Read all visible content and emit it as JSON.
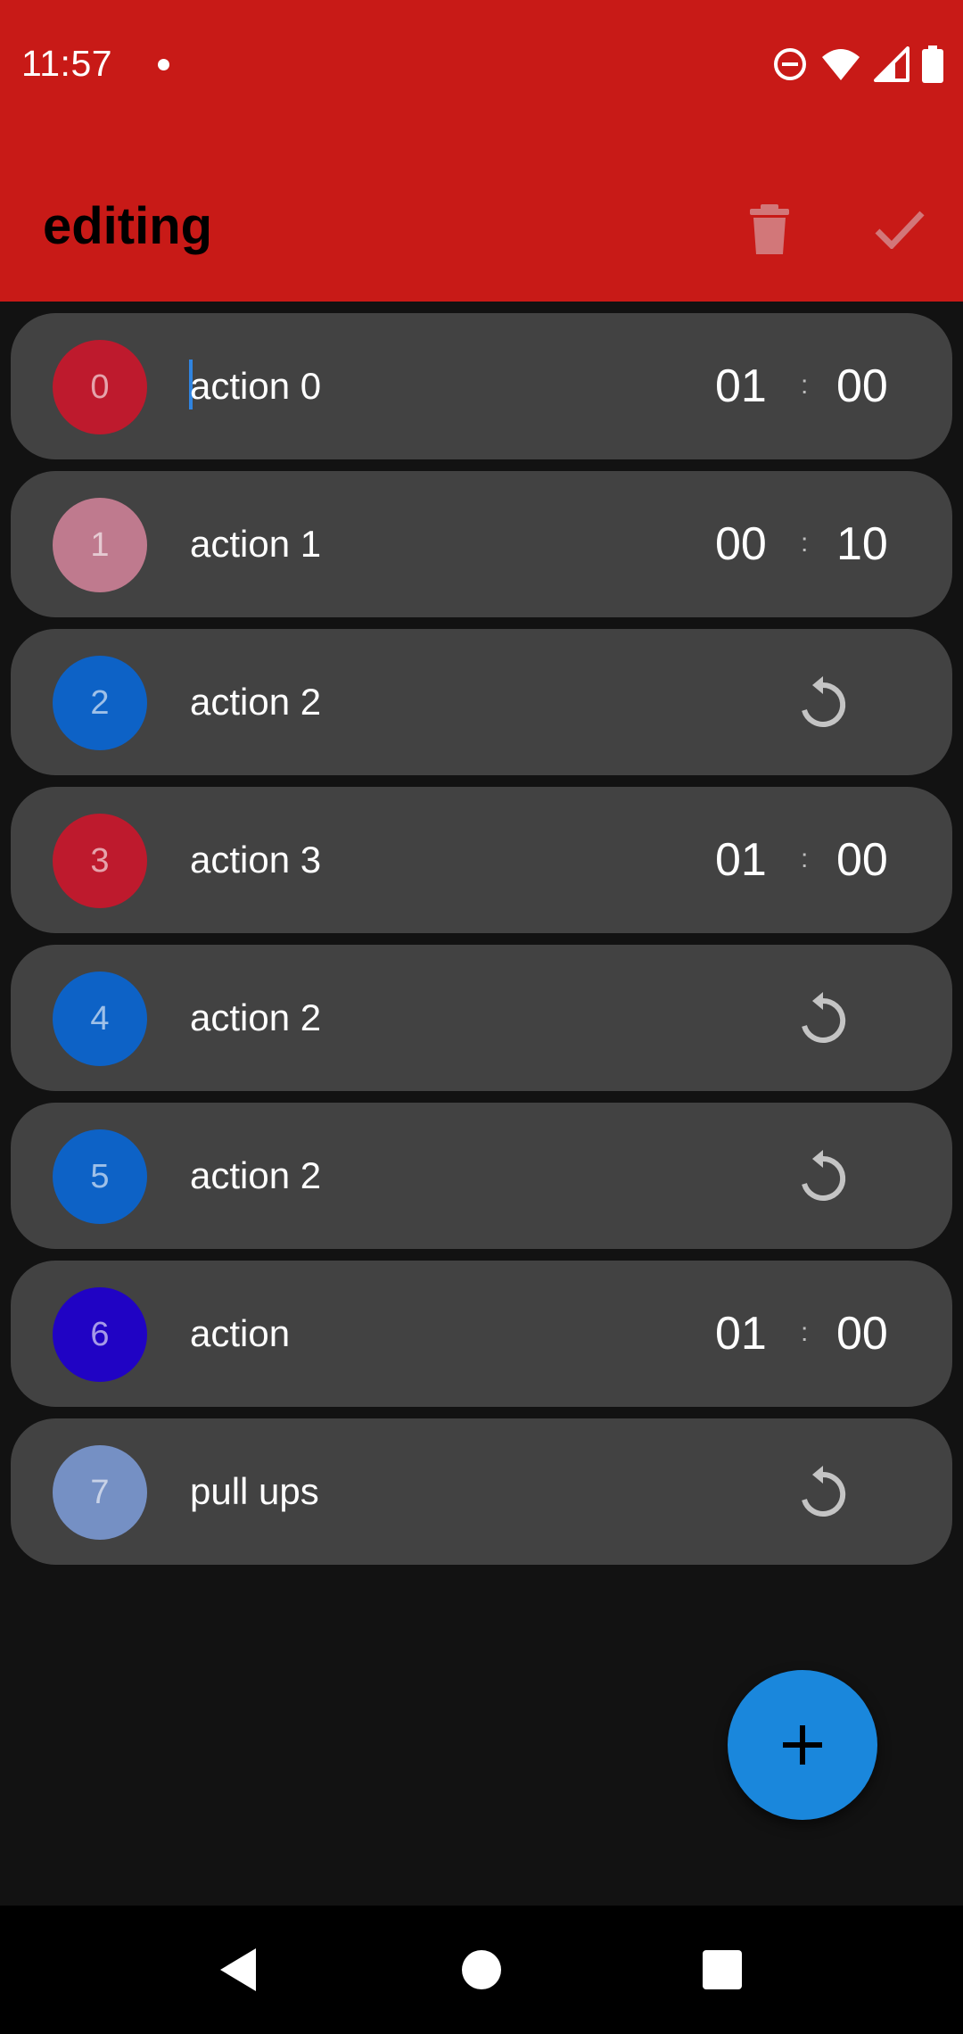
{
  "status_bar": {
    "time": "11:57"
  },
  "app_bar": {
    "title": "editing"
  },
  "colors": {
    "header": "#c81a17",
    "row_bg": "#424242",
    "fab": "#1a87dc",
    "caret": "#2f84e0"
  },
  "actions": [
    {
      "index": "0",
      "name": "action 0",
      "color": "#be1a2d",
      "type": "timer",
      "minutes": "01",
      "seconds": "00",
      "focused": true
    },
    {
      "index": "1",
      "name": "action 1",
      "color": "#bf7a8e",
      "type": "timer",
      "minutes": "00",
      "seconds": "10"
    },
    {
      "index": "2",
      "name": "action 2",
      "color": "#0d62c6",
      "type": "repeat",
      "icon": "repeat-icon"
    },
    {
      "index": "3",
      "name": "action 3",
      "color": "#be1a2d",
      "type": "timer",
      "minutes": "01",
      "seconds": "00"
    },
    {
      "index": "4",
      "name": "action 2",
      "color": "#0d62c6",
      "type": "repeat",
      "icon": "repeat-icon"
    },
    {
      "index": "5",
      "name": "action 2",
      "color": "#0d62c6",
      "type": "repeat",
      "icon": "repeat-icon"
    },
    {
      "index": "6",
      "name": "action",
      "color": "#2003c4",
      "type": "timer",
      "minutes": "01",
      "seconds": "00"
    },
    {
      "index": "7",
      "name": "pull ups",
      "color": "#7590c4",
      "type": "repeat",
      "icon": "repeat-icon"
    }
  ],
  "timer_separator": ":",
  "icons": {
    "delete": "trash-icon",
    "confirm": "check-icon",
    "fab": "plus-icon",
    "nav": [
      "back-icon",
      "home-icon",
      "recents-icon"
    ]
  }
}
